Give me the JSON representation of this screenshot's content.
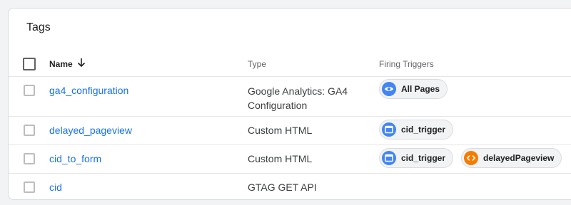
{
  "panel": {
    "title": "Tags"
  },
  "table": {
    "columns": {
      "name": "Name",
      "type": "Type",
      "triggers": "Firing Triggers"
    },
    "sort": {
      "column": "Name",
      "direction": "descending-arrow"
    },
    "rows": [
      {
        "name": "ga4_configuration",
        "type_line1": "Google Analytics: GA4",
        "type_line2": "Configuration",
        "triggers": [
          {
            "label": "All Pages",
            "icon": "eye-icon",
            "color": "#4285f4"
          }
        ]
      },
      {
        "name": "delayed_pageview",
        "type_line1": "Custom HTML",
        "triggers": [
          {
            "label": "cid_trigger",
            "icon": "window-icon",
            "color": "#4285f4"
          }
        ]
      },
      {
        "name": "cid_to_form",
        "type_line1": "Custom HTML",
        "triggers": [
          {
            "label": "cid_trigger",
            "icon": "window-icon",
            "color": "#4285f4"
          },
          {
            "label": "delayedPageview",
            "icon": "code-brackets-icon",
            "color": "#f57c00"
          }
        ]
      },
      {
        "name": "cid",
        "type_line1": "GTAG GET API",
        "triggers": []
      }
    ]
  },
  "colors": {
    "link": "#1a73e8",
    "trigger_blue": "#4285f4",
    "trigger_orange": "#f57c00"
  }
}
